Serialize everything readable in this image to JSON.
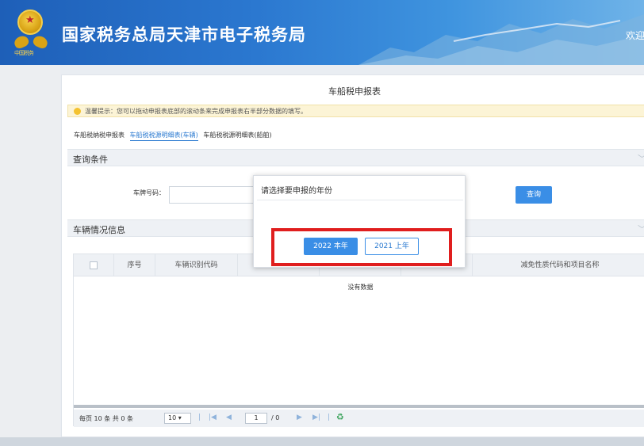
{
  "header": {
    "site_title": "国家税务总局天津市电子税务局",
    "welcome": "欢迎，",
    "emblem_label": "中国税务"
  },
  "page": {
    "title": "车船税申报表",
    "notice": "温馨提示：您可以拖动申报表底部的滚动条来完成申报表右半部分数据的填写。",
    "tabs": [
      {
        "label": "车船税纳税申报表",
        "active": false
      },
      {
        "label": "车船税税源明细表(车辆)",
        "active": true
      },
      {
        "label": "车船税税源明细表(船舶)",
        "active": false
      }
    ]
  },
  "query": {
    "section_title": "查询条件",
    "plate_label": "车牌号码：",
    "plate_value": "",
    "query_button": "查询"
  },
  "vehicle": {
    "section_title": "车辆情况信息",
    "columns": [
      "",
      "序号",
      "车辆识别代码",
      "",
      "",
      "",
      "减免性质代码和项目名称"
    ],
    "no_data": "没有数据"
  },
  "pager": {
    "info": "每页 10 条 共 0 条",
    "page_size": "10",
    "current_page": "1",
    "total_pages": "/ 0"
  },
  "modal": {
    "title": "请选择要申报的年份",
    "buttons": [
      "2022 本年",
      "2021 上年"
    ]
  },
  "colors": {
    "primary": "#3a8ee6",
    "highlight": "#e01e1e",
    "header": "#1e5fb8"
  }
}
